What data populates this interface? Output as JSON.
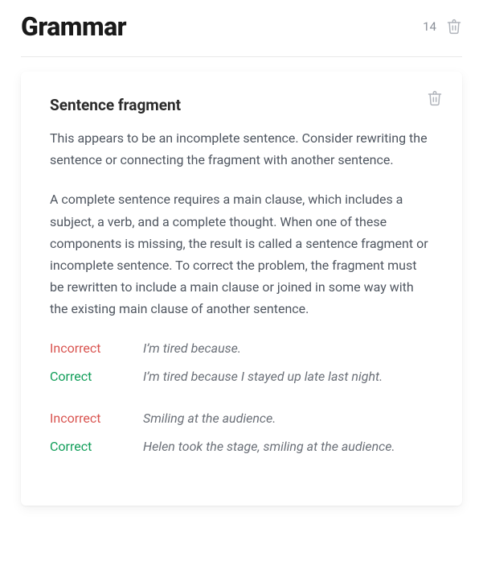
{
  "header": {
    "title": "Grammar",
    "count": "14"
  },
  "card": {
    "title": "Sentence fragment",
    "summary": "This appears to be an incomplete sentence. Consider rewriting the sentence or connecting the fragment with another sentence.",
    "explanation": "A complete sentence requires a main clause, which includes a subject, a verb, and a complete thought. When one of these components is missing, the result is called a sentence fragment or incomplete sentence. To correct the problem, the fragment must be rewritten to include a main clause or joined in some way with the existing main clause of another sentence.",
    "labels": {
      "incorrect": "Incorrect",
      "correct": "Correct"
    },
    "examples": [
      {
        "incorrect": "I’m tired because.",
        "correct": "I’m tired because I stayed up late last night."
      },
      {
        "incorrect": "Smiling at the audience.",
        "correct": "Helen took the stage, smiling at the audience."
      }
    ]
  }
}
